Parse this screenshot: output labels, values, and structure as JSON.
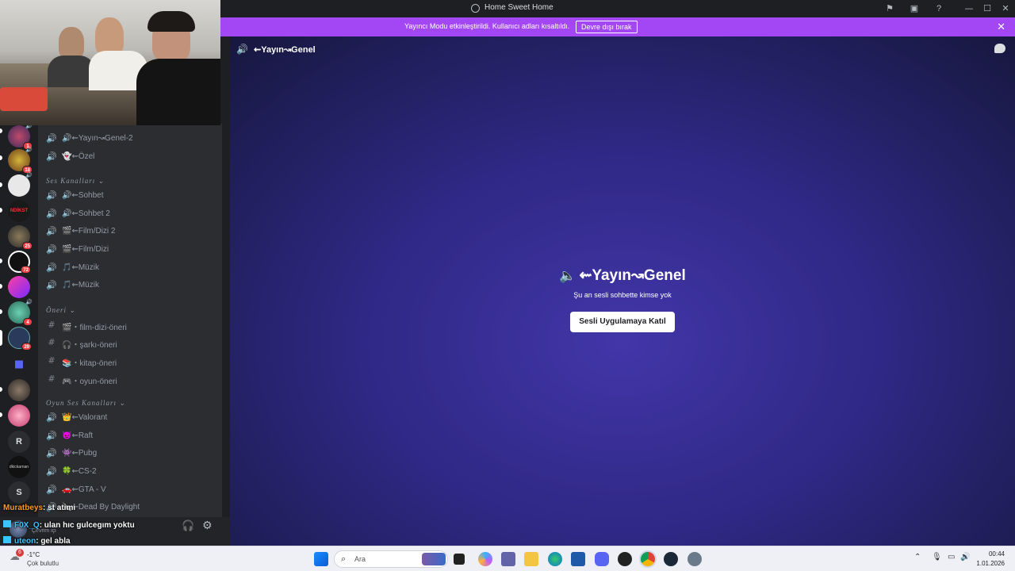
{
  "window": {
    "title": "Home Sweet Home"
  },
  "banner": {
    "message": "Yayıncı Modu etkinleştirildi. Kullanıcı adları kısaltıldı.",
    "button": "Devre dışı bırak"
  },
  "header": {
    "channel": "⇜Yayın↝Genel"
  },
  "stage": {
    "channel": "⇜Yayın↝Genel",
    "status": "Şu an sesli sohbette kimse yok",
    "join": "Sesli Uygulamaya Katıl"
  },
  "channels": {
    "top": [
      {
        "icon": "🔊",
        "name": "🔊⇜Yayın↝Genel-2"
      },
      {
        "icon": "🔊",
        "name": "👻⇜Özel"
      }
    ],
    "voice_cat": "Ses Kanalları ⌄",
    "voice": [
      {
        "icon": "🔊",
        "name": "🔊⇜Sohbet"
      },
      {
        "icon": "🔊",
        "name": "🔊⇜Sohbet 2"
      },
      {
        "icon": "🔊",
        "name": "🎬⇜Film/Dizi 2"
      },
      {
        "icon": "🔊",
        "name": "🎬⇜Film/Dizi"
      },
      {
        "icon": "🔊",
        "name": "🎵⇜Müzik"
      },
      {
        "icon": "🔊",
        "name": "🎵⇜Müzik"
      }
    ],
    "suggest_cat": "Öneri ⌄",
    "suggest": [
      {
        "icon": "#",
        "name": "🎬・film-dizi-öneri"
      },
      {
        "icon": "#",
        "name": "🎧・şarkı-öneri"
      },
      {
        "icon": "#",
        "name": "📚・kitap-öneri"
      },
      {
        "icon": "#",
        "name": "🎮・oyun-öneri"
      }
    ],
    "game_cat": "Oyun Ses Kanalları ⌄",
    "game": [
      {
        "icon": "🔊",
        "name": "👑⇜Valorant"
      },
      {
        "icon": "🔊",
        "name": "😈⇜Raft"
      },
      {
        "icon": "🔊",
        "name": "👾⇜Pubg"
      },
      {
        "icon": "🔊",
        "name": "🍀⇜CS-2"
      },
      {
        "icon": "🔊",
        "name": "🚗⇜GTA - V"
      },
      {
        "icon": "🔊",
        "name": "🔪⇜Dead By Daylight"
      }
    ]
  },
  "servers": {
    "badges": [
      "1",
      "18",
      "25",
      "72",
      "4",
      "29"
    ],
    "letters": [
      "R",
      "S"
    ],
    "labels": [
      "NDİKST",
      "dkickarnan"
    ]
  },
  "userbar": {
    "status": "Çevrim içi"
  },
  "overlay_chat": [
    {
      "user": "Muratbeys",
      "text": ": st atimi"
    },
    {
      "user": "F0X_Q",
      "text": ": ulan hıc gulcegım yoktu"
    },
    {
      "user": "uteon",
      "text": ": gel abla"
    }
  ],
  "taskbar": {
    "weather_temp": "-1°C",
    "weather_desc": "Çok bulutlu",
    "weather_badge": "6",
    "search": "Ara",
    "time": "00:44",
    "date": "1.01.2026"
  },
  "colors": {
    "banner": "#a347f5",
    "stage": "#2f2884",
    "username_orange": "#ff9a1f",
    "username_cyan": "#39c5ff"
  }
}
